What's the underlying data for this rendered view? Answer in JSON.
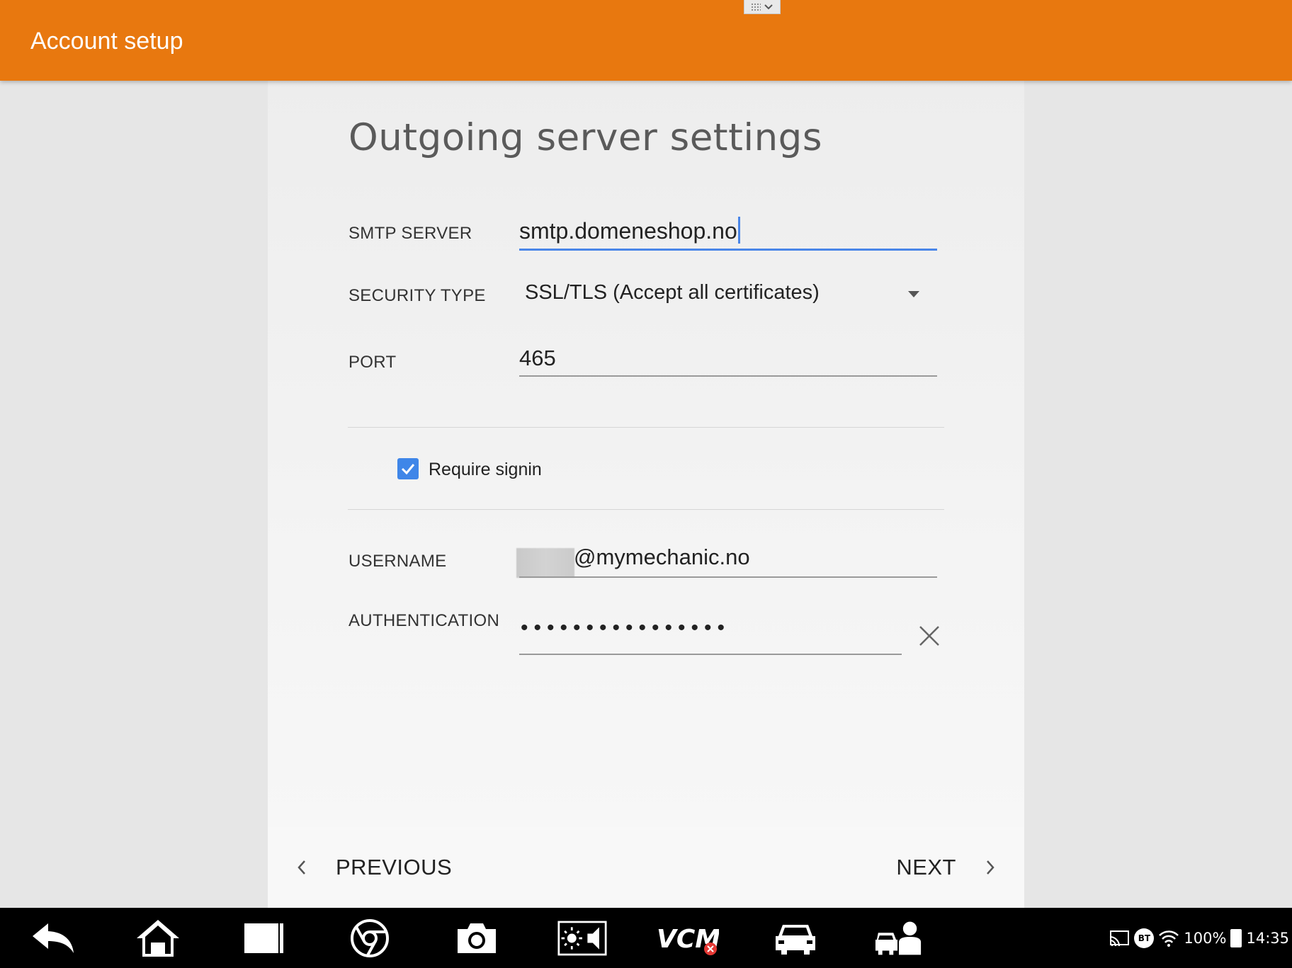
{
  "appbar": {
    "title": "Account setup"
  },
  "page": {
    "title": "Outgoing server settings"
  },
  "form": {
    "smtp_server": {
      "label": "SMTP SERVER",
      "value": "smtp.domeneshop.no"
    },
    "security_type": {
      "label": "SECURITY TYPE",
      "value": "SSL/TLS (Accept all certificates)"
    },
    "port": {
      "label": "PORT",
      "value": "465"
    },
    "require_signin": {
      "label": "Require signin",
      "checked": true
    },
    "username": {
      "label": "USERNAME",
      "value": "@mymechanic.no"
    },
    "authentication": {
      "label": "AUTHENTICATION",
      "value": "••••••••••••••••"
    }
  },
  "wizard": {
    "previous": "PREVIOUS",
    "next": "NEXT"
  },
  "status_bar": {
    "bt": "BT",
    "battery": "100%",
    "time": "14:35"
  },
  "colors": {
    "accent": "#e8780f",
    "focus": "#4a86e8",
    "checkbox": "#3f86e8"
  },
  "nav_icons": [
    "back-icon",
    "home-icon",
    "recent-apps-icon",
    "browser-icon",
    "camera-icon",
    "brightness-volume-icon",
    "vcm-icon",
    "car-icon",
    "mechanic-icon"
  ]
}
